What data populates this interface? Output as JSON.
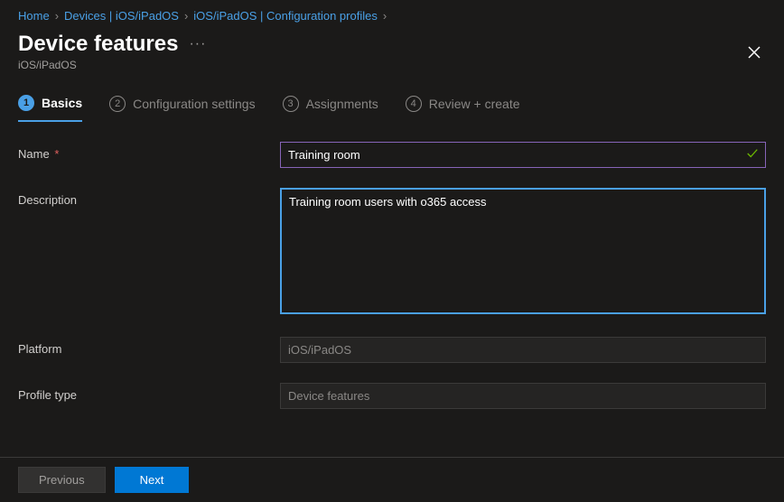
{
  "breadcrumb": {
    "items": [
      "Home",
      "Devices | iOS/iPadOS",
      "iOS/iPadOS | Configuration profiles"
    ]
  },
  "header": {
    "title": "Device features",
    "subtitle": "iOS/iPadOS"
  },
  "steps": {
    "s1": {
      "num": "1",
      "label": "Basics"
    },
    "s2": {
      "num": "2",
      "label": "Configuration settings"
    },
    "s3": {
      "num": "3",
      "label": "Assignments"
    },
    "s4": {
      "num": "4",
      "label": "Review + create"
    }
  },
  "form": {
    "name_label": "Name",
    "required_marker": "*",
    "name_value": "Training room",
    "description_label": "Description",
    "description_value": "Training room users with o365 access",
    "platform_label": "Platform",
    "platform_value": "iOS/iPadOS",
    "profiletype_label": "Profile type",
    "profiletype_value": "Device features"
  },
  "footer": {
    "previous": "Previous",
    "next": "Next"
  }
}
